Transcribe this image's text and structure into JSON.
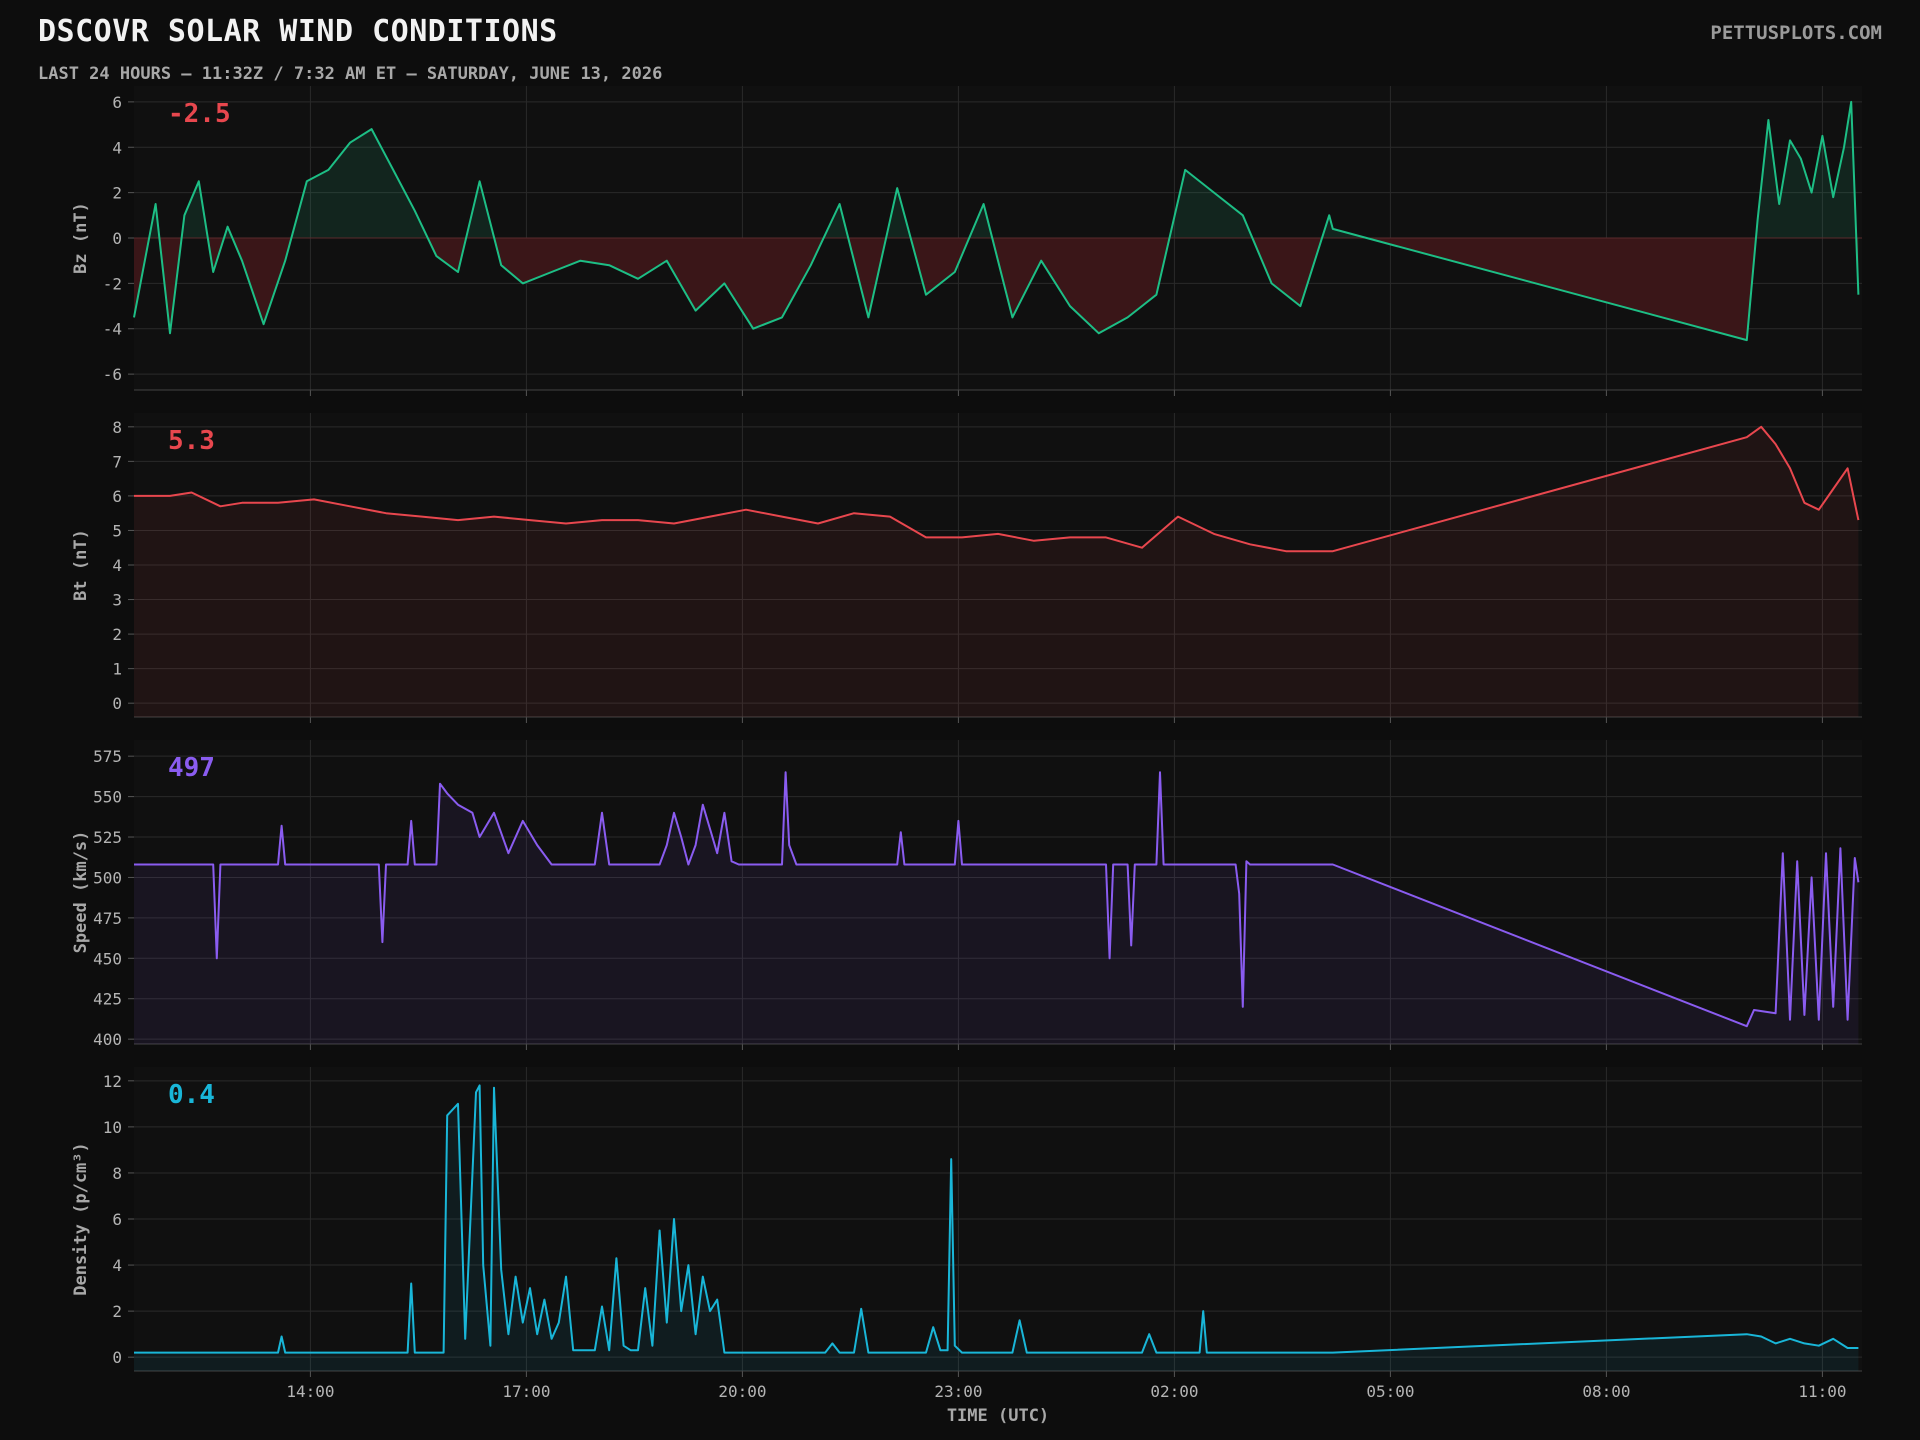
{
  "header": {
    "title": "DSCOVR SOLAR WIND CONDITIONS",
    "subtitle": "LAST 24 HOURS — 11:32Z / 7:32 AM ET — SATURDAY, JUNE 13, 2026",
    "brand": "PETTUSPLOTS.COM"
  },
  "colors": {
    "background": "#0d0d0d",
    "bz": "#1dbe85",
    "bt": "#e8474e",
    "speed": "#8a5cf0",
    "density": "#19b6d8",
    "negative_fill": "#3a1618",
    "grid": "#2a2a2a"
  },
  "chart_data": [
    {
      "id": "bz",
      "type": "line",
      "ylabel": "Bz (nT)",
      "current_value": "-2.5",
      "current_color": "#e8474e",
      "color": "#1dbe85",
      "ylim": [
        -6.7,
        6.7
      ],
      "yticks": [
        -6,
        -4,
        -2,
        0,
        2,
        4,
        6
      ],
      "fill": "zero",
      "x_hours": [
        0,
        0.3,
        0.5,
        0.7,
        0.9,
        1.1,
        1.3,
        1.5,
        1.8,
        2.1,
        2.4,
        2.7,
        3.0,
        3.3,
        3.6,
        3.9,
        4.2,
        4.5,
        4.8,
        5.1,
        5.4,
        5.8,
        6.2,
        6.6,
        7.0,
        7.4,
        7.8,
        8.2,
        8.6,
        9.0,
        9.4,
        9.8,
        10.2,
        10.6,
        11.0,
        11.4,
        11.8,
        12.2,
        12.6,
        13.0,
        13.4,
        13.8,
        14.2,
        14.6,
        15.0,
        15.4,
        15.8,
        16.2,
        16.6,
        16.65,
        22.4,
        22.55,
        22.7,
        22.85,
        23.0,
        23.15,
        23.3,
        23.45,
        23.6,
        23.75,
        23.85,
        23.95
      ],
      "values": [
        -3.5,
        1.5,
        -4.2,
        1.0,
        2.5,
        -1.5,
        0.5,
        -1.0,
        -3.8,
        -1.0,
        2.5,
        3.0,
        4.2,
        4.8,
        3.0,
        1.2,
        -0.8,
        -1.5,
        2.5,
        -1.2,
        -2.0,
        -1.5,
        -1.0,
        -1.2,
        -1.8,
        -1.0,
        -3.2,
        -2.0,
        -4.0,
        -3.5,
        -1.2,
        1.5,
        -3.5,
        2.2,
        -2.5,
        -1.5,
        1.5,
        -3.5,
        -1.0,
        -3.0,
        -4.2,
        -3.5,
        -2.5,
        3.0,
        2.0,
        1.0,
        -2.0,
        -3.0,
        1.0,
        0.4,
        -4.5,
        0.8,
        5.2,
        1.5,
        4.3,
        3.5,
        2.0,
        4.5,
        1.8,
        4.0,
        6.0,
        -2.5
      ]
    },
    {
      "id": "bt",
      "type": "line",
      "ylabel": "Bt (nT)",
      "current_value": "5.3",
      "current_color": "#e8474e",
      "color": "#e8474e",
      "ylim": [
        -0.4,
        8.4
      ],
      "yticks": [
        0,
        1,
        2,
        3,
        4,
        5,
        6,
        7,
        8
      ],
      "fill": "bottom",
      "x_hours": [
        0,
        0.5,
        0.8,
        1.2,
        1.5,
        2.0,
        2.5,
        3.0,
        3.5,
        4.0,
        4.5,
        5.0,
        5.5,
        6.0,
        6.5,
        7.0,
        7.5,
        8.0,
        8.5,
        9.0,
        9.5,
        10.0,
        10.5,
        11.0,
        11.5,
        12.0,
        12.5,
        13.0,
        13.5,
        14.0,
        14.5,
        15.0,
        15.5,
        16.0,
        16.65,
        22.4,
        22.6,
        22.8,
        23.0,
        23.2,
        23.4,
        23.6,
        23.8,
        23.95
      ],
      "values": [
        6.0,
        6.0,
        6.1,
        5.7,
        5.8,
        5.8,
        5.9,
        5.7,
        5.5,
        5.4,
        5.3,
        5.4,
        5.3,
        5.2,
        5.3,
        5.3,
        5.2,
        5.4,
        5.6,
        5.4,
        5.2,
        5.5,
        5.4,
        4.8,
        4.8,
        4.9,
        4.7,
        4.8,
        4.8,
        4.5,
        5.4,
        4.9,
        4.6,
        4.4,
        4.4,
        7.7,
        8.0,
        7.5,
        6.8,
        5.8,
        5.6,
        6.2,
        6.8,
        5.3
      ]
    },
    {
      "id": "speed",
      "type": "line",
      "ylabel": "Speed (km/s)",
      "current_value": "497",
      "current_color": "#8a5cf0",
      "color": "#8a5cf0",
      "ylim": [
        397,
        585
      ],
      "yticks": [
        400,
        425,
        450,
        475,
        500,
        525,
        550,
        575
      ],
      "fill": "bottom",
      "x_hours": [
        0,
        1.1,
        1.15,
        1.2,
        2.0,
        2.05,
        2.1,
        3.4,
        3.45,
        3.5,
        3.8,
        3.85,
        3.9,
        4.2,
        4.25,
        4.3,
        4.35,
        4.5,
        4.7,
        4.8,
        5.0,
        5.2,
        5.4,
        5.6,
        5.8,
        5.85,
        6.4,
        6.5,
        6.6,
        6.7,
        6.8,
        7.3,
        7.4,
        7.5,
        7.6,
        7.7,
        7.8,
        7.9,
        8.0,
        8.1,
        8.2,
        8.3,
        8.4,
        9.0,
        9.05,
        9.1,
        9.2,
        10.6,
        10.65,
        10.7,
        11.4,
        11.45,
        11.5,
        13.5,
        13.55,
        13.6,
        13.8,
        13.85,
        13.9,
        14.2,
        14.25,
        14.3,
        15.3,
        15.35,
        15.4,
        15.45,
        15.5,
        16.65,
        22.4,
        22.5,
        22.8,
        22.9,
        23.0,
        23.1,
        23.2,
        23.3,
        23.4,
        23.5,
        23.6,
        23.7,
        23.8,
        23.9,
        23.95
      ],
      "values": [
        508,
        508,
        450,
        508,
        508,
        532,
        508,
        508,
        460,
        508,
        508,
        535,
        508,
        508,
        558,
        555,
        552,
        545,
        540,
        525,
        540,
        515,
        535,
        520,
        508,
        508,
        508,
        540,
        508,
        508,
        508,
        508,
        520,
        540,
        525,
        508,
        520,
        545,
        530,
        515,
        540,
        510,
        508,
        508,
        565,
        520,
        508,
        508,
        528,
        508,
        508,
        535,
        508,
        508,
        450,
        508,
        508,
        458,
        508,
        508,
        565,
        508,
        508,
        490,
        420,
        510,
        508,
        508,
        408,
        418,
        416,
        515,
        412,
        510,
        415,
        500,
        412,
        515,
        420,
        518,
        412,
        512,
        497
      ]
    },
    {
      "id": "density",
      "type": "line",
      "ylabel": "Density (p/cm³)",
      "current_value": "0.4",
      "current_color": "#19b6d8",
      "color": "#19b6d8",
      "ylim": [
        -0.6,
        12.6
      ],
      "yticks": [
        0,
        2,
        4,
        6,
        8,
        10,
        12
      ],
      "fill": "bottom",
      "x_hours": [
        0,
        2.0,
        2.05,
        2.1,
        3.8,
        3.85,
        3.9,
        4.3,
        4.35,
        4.5,
        4.6,
        4.75,
        4.8,
        4.85,
        4.95,
        5.0,
        5.1,
        5.2,
        5.3,
        5.4,
        5.5,
        5.6,
        5.7,
        5.8,
        5.9,
        6.0,
        6.1,
        6.2,
        6.4,
        6.5,
        6.6,
        6.7,
        6.8,
        6.9,
        7.0,
        7.1,
        7.2,
        7.3,
        7.4,
        7.5,
        7.6,
        7.7,
        7.8,
        7.9,
        8.0,
        8.1,
        8.2,
        9.6,
        9.7,
        9.8,
        10.0,
        10.1,
        10.2,
        11.0,
        11.1,
        11.2,
        11.3,
        11.35,
        11.4,
        11.5,
        12.2,
        12.3,
        12.4,
        14.0,
        14.1,
        14.2,
        14.8,
        14.85,
        14.9,
        15.0,
        16.65,
        22.4,
        22.6,
        22.8,
        23.0,
        23.2,
        23.4,
        23.6,
        23.8,
        23.95
      ],
      "values": [
        0.2,
        0.2,
        0.9,
        0.2,
        0.2,
        3.2,
        0.2,
        0.2,
        10.5,
        11.0,
        0.8,
        11.5,
        11.8,
        4.0,
        0.5,
        11.7,
        3.8,
        1.0,
        3.5,
        1.5,
        3.0,
        1.0,
        2.5,
        0.8,
        1.5,
        3.5,
        0.3,
        0.3,
        0.3,
        2.2,
        0.3,
        4.3,
        0.5,
        0.3,
        0.3,
        3.0,
        0.5,
        5.5,
        1.5,
        6.0,
        2.0,
        4.0,
        1.0,
        3.5,
        2.0,
        2.5,
        0.2,
        0.2,
        0.6,
        0.2,
        0.2,
        2.1,
        0.2,
        0.2,
        1.3,
        0.3,
        0.3,
        8.6,
        0.5,
        0.2,
        0.2,
        1.6,
        0.2,
        0.2,
        1.0,
        0.2,
        0.2,
        2.0,
        0.2,
        0.2,
        0.2,
        1.0,
        0.9,
        0.6,
        0.8,
        0.6,
        0.5,
        0.8,
        0.4,
        0.4
      ]
    }
  ],
  "x_axis": {
    "label": "TIME (UTC)",
    "tick_labels": [
      "14:00",
      "17:00",
      "20:00",
      "23:00",
      "02:00",
      "05:00",
      "08:00",
      "11:00"
    ],
    "tick_hours": [
      2.45,
      5.45,
      8.45,
      11.45,
      14.45,
      17.45,
      20.45,
      23.45
    ],
    "range_hours": [
      0,
      24
    ]
  }
}
